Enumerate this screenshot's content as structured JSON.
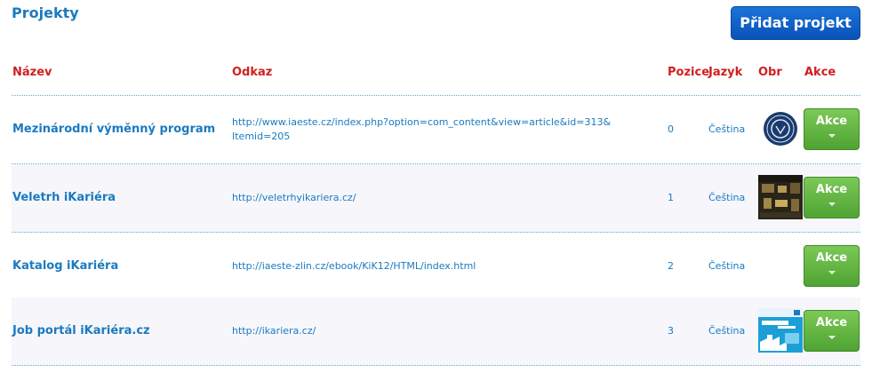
{
  "page": {
    "title": "Projekty",
    "add_button": "Přidat projekt"
  },
  "table": {
    "headers": {
      "name": "Název",
      "link": "Odkaz",
      "position": "Pozice",
      "language": "Jazyk",
      "image": "Obr",
      "actions": "Akce"
    },
    "rows": [
      {
        "name": "Mezinárodní výměnný program",
        "link_line1": "http://www.iaeste.cz/index.php?option=com_content&view=article&id=313&",
        "link_line2": "Itemid=205",
        "position": "0",
        "language": "Čeština",
        "image": "iaeste-seal",
        "action": "Akce"
      },
      {
        "name": "Veletrh iKariéra",
        "link_line1": "http://veletrhyikariera.cz/",
        "link_line2": "",
        "position": "1",
        "language": "Čeština",
        "image": "fair-photo",
        "action": "Akce"
      },
      {
        "name": "Katalog iKariéra",
        "link_line1": "http://iaeste-zlin.cz/ebook/KiK12/HTML/index.html",
        "link_line2": "",
        "position": "2",
        "language": "Čeština",
        "image": "",
        "action": "Akce"
      },
      {
        "name": "Job portál iKariéra.cz",
        "link_line1": "http://ikariera.cz/",
        "link_line2": "",
        "position": "3",
        "language": "Čeština",
        "image": "portal-graphic",
        "action": "Akce"
      }
    ]
  },
  "colors": {
    "title": "#1a7ac0",
    "header": "#d01f1f",
    "primary_button": "#0a52b8",
    "action_button": "#5aad3a"
  }
}
